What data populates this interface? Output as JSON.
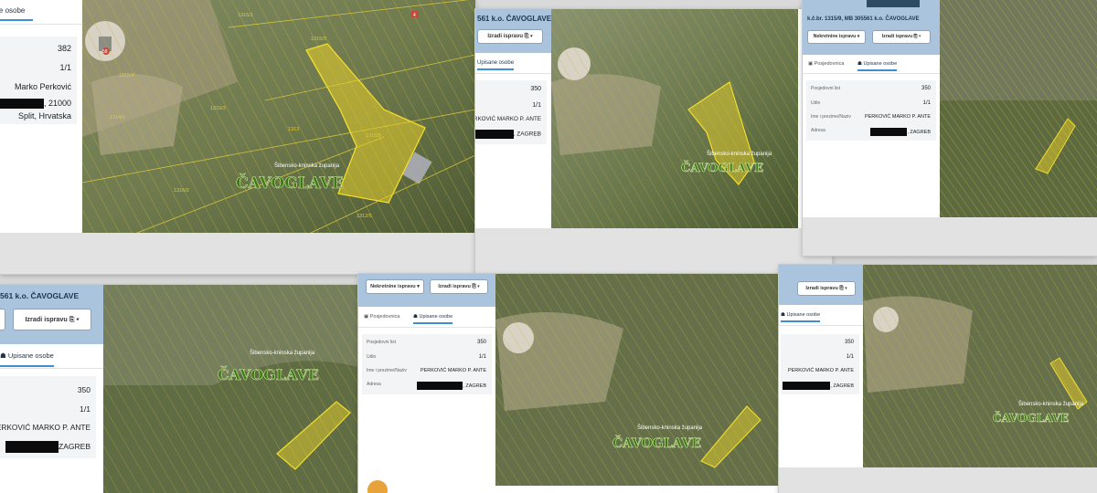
{
  "cadastral": {
    "title": "k.č.br. 1315/9, MB 305561 k.o. ČAVOGLAVE",
    "title_short": "561 k.o. ČAVOGLAVE",
    "tab_parcel": "Posjedovnica",
    "tab_persons": "Upisane osobe",
    "btn_real_estate": "Nekretnine ispravu ▾",
    "btn_real_estate_short": "Nekretnine ispravu ▾",
    "btn_make_doc": "Izradi ispravu ⎘ ▾",
    "labels": {
      "list": "Posjedovni list",
      "share": "Udio",
      "name": "Ime i prezime/Naziv",
      "address": "Adresa"
    }
  },
  "shot1": {
    "list_value": "382",
    "share_value": "1/1",
    "name_value": "Marko Perković",
    "address_suffix": ", 21000",
    "address_city": "Split, Hrvatska",
    "map_town": "ČAVOGLAVE",
    "map_county": "Šibensko-kninska županija",
    "house_a": "58",
    "house_b": "4"
  },
  "shot_common": {
    "list_value": "350",
    "share_value": "1/1",
    "name_value": "PERKOVIĆ MARKO P. ANTE",
    "address_suffix": ", ZAGREB",
    "address_suffix_tight": "ZAGREB",
    "map_town": "ČAVOGLAVE",
    "map_county": "Šibensko-kninska županija"
  },
  "colors": {
    "header": "#a9c4dc",
    "accent": "#3d8fd1",
    "parcel_line": "#d4c33a",
    "parcel_fill": "#e8cf2a",
    "town_text": "#3c7a12"
  }
}
